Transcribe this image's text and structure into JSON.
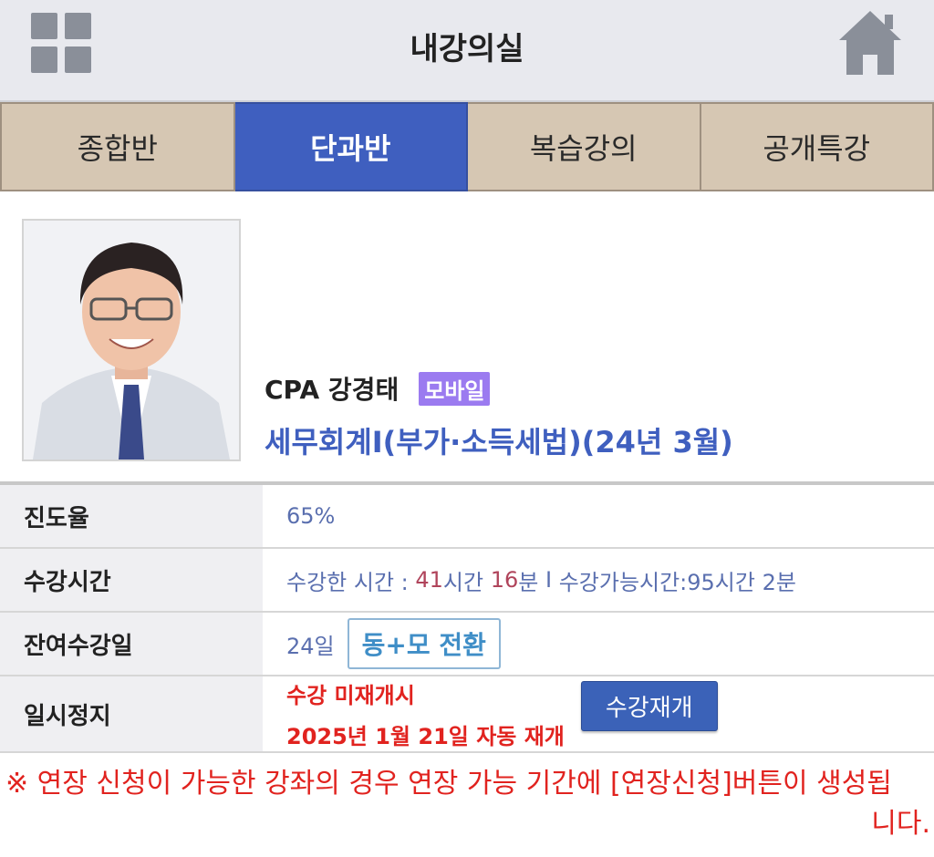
{
  "header": {
    "title": "내강의실",
    "menu_icon": "grid-menu-icon",
    "home_icon": "home-icon"
  },
  "tabs": [
    {
      "label": "종합반",
      "active": false
    },
    {
      "label": "단과반",
      "active": true
    },
    {
      "label": "복습강의",
      "active": false
    },
    {
      "label": "공개특강",
      "active": false
    }
  ],
  "course": {
    "teacher": "CPA 강경태",
    "badge": "모바일",
    "title": "세무회계I(부가·소득세법)(24년 3월)"
  },
  "info": {
    "progress": {
      "label": "진도율",
      "value": "65%"
    },
    "study_time": {
      "label": "수강시간",
      "prefix": "수강한 시간 : ",
      "hours": "41",
      "hours_unit": "시간 ",
      "minutes": "16",
      "minutes_unit": "분",
      "separator": " I ",
      "available": "수강가능시간:95시간 2분"
    },
    "remaining": {
      "label": "잔여수강일",
      "value": "24일",
      "button": "동+모 전환"
    },
    "pause": {
      "label": "일시정지",
      "status": "수강 미재개시",
      "resume_date": "2025년 1월 21일 자동 재개",
      "button": "수강재개"
    }
  },
  "notice": {
    "line1": "※ 연장 신청이 가능한 강좌의 경우 연장 가능 기간에 [연장신청]버튼이 생성됩",
    "line2": "니다."
  },
  "colors": {
    "accent": "#3f5fbf",
    "tab_bg": "#d6c7b3",
    "warning": "#e1231f",
    "badge": "#9b7bf0"
  }
}
